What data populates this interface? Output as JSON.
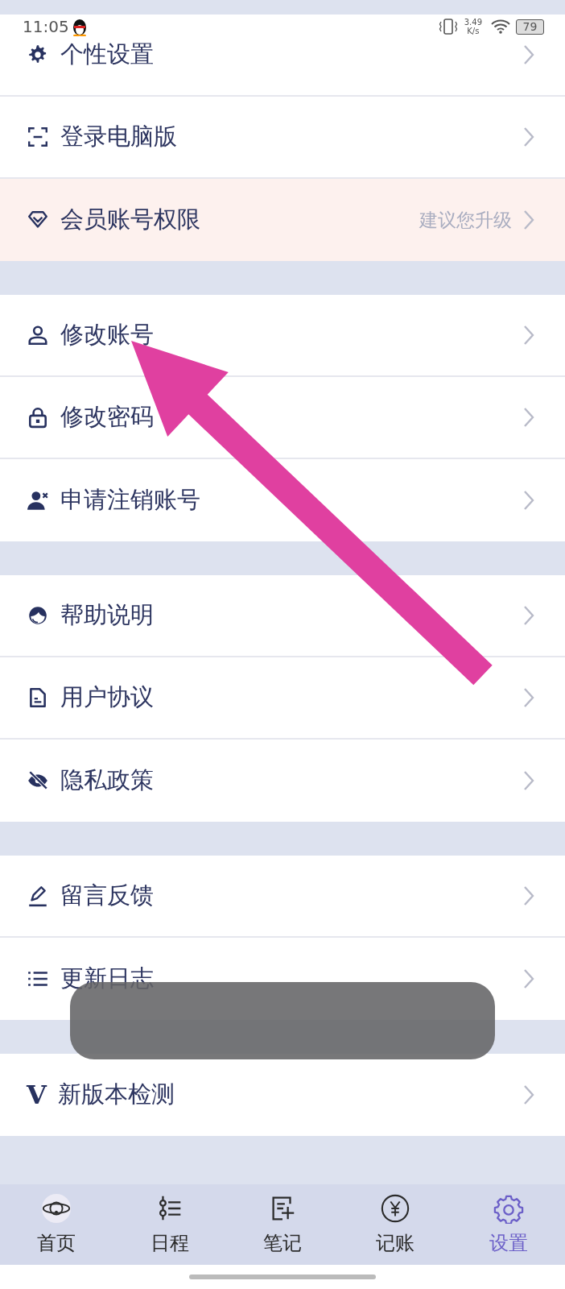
{
  "status_bar": {
    "time": "11:05",
    "speed_value": "3.49",
    "speed_unit": "K/s",
    "battery": "79"
  },
  "sections": [
    {
      "items": [
        {
          "label": "个性设置",
          "highlighted": false
        },
        {
          "label": "登录电脑版",
          "highlighted": false
        },
        {
          "label": "会员账号权限",
          "hint": "建议您升级",
          "highlighted": true
        }
      ]
    },
    {
      "items": [
        {
          "label": "修改账号",
          "highlighted": false
        },
        {
          "label": "修改密码",
          "highlighted": false
        },
        {
          "label": "申请注销账号",
          "highlighted": false
        }
      ]
    },
    {
      "items": [
        {
          "label": "帮助说明",
          "highlighted": false
        },
        {
          "label": "用户协议",
          "highlighted": false
        },
        {
          "label": "隐私政策",
          "highlighted": false
        }
      ]
    },
    {
      "items": [
        {
          "label": "留言反馈",
          "highlighted": false
        },
        {
          "label": "更新日志",
          "highlighted": false
        }
      ]
    },
    {
      "items": [
        {
          "label": "新版本检测",
          "glyph": "V",
          "highlighted": false
        }
      ]
    }
  ],
  "tab_bar": [
    {
      "label": "首页",
      "selected": false
    },
    {
      "label": "日程",
      "selected": false
    },
    {
      "label": "笔记",
      "selected": false
    },
    {
      "label": "记账",
      "selected": false
    },
    {
      "label": "设置",
      "selected": true
    }
  ]
}
